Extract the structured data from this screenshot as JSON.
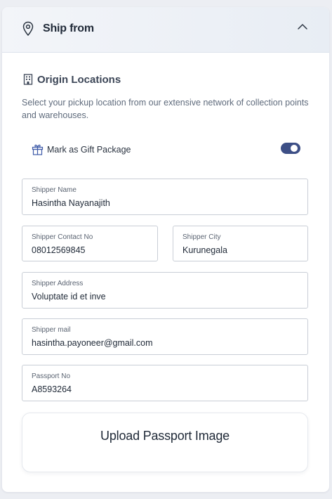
{
  "header": {
    "title": "Ship from",
    "pin_icon": "map-pin-icon",
    "chevron_icon": "chevron-up-icon"
  },
  "section": {
    "title": "Origin Locations",
    "icon": "building-icon",
    "description": "Select your pickup location from our extensive network of collection points and warehouses."
  },
  "gift": {
    "label": "Mark as Gift Package",
    "icon": "gift-icon",
    "enabled": true
  },
  "fields": {
    "shipper_name": {
      "label": "Shipper Name",
      "value": "Hasintha Nayanajith"
    },
    "shipper_contact": {
      "label": "Shipper Contact No",
      "value": "08012569845"
    },
    "shipper_city": {
      "label": "Shipper City",
      "value": "Kurunegala"
    },
    "shipper_address": {
      "label": "Shipper Address",
      "value": "Voluptate id et inve"
    },
    "shipper_mail": {
      "label": "Shipper mail",
      "value": "hasintha.payoneer@gmail.com"
    },
    "passport_no": {
      "label": "Passport No",
      "value": "A8593264"
    }
  },
  "upload": {
    "label": "Upload Passport Image"
  },
  "colors": {
    "accent": "#3d4f86",
    "header_bg": "#eaeef4",
    "border": "#c9ced6"
  }
}
